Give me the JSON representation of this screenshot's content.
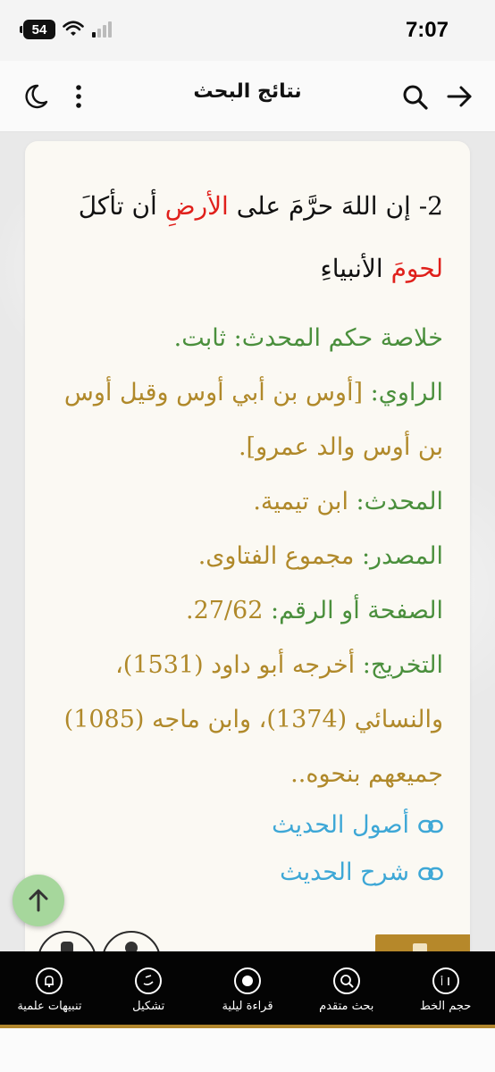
{
  "status_bar": {
    "time": "7:07",
    "battery": "54"
  },
  "header": {
    "title": "نتائج البحث"
  },
  "hadith": {
    "number": "2-",
    "text_before": "إن اللهَ حرَّمَ على",
    "word_earth": "الأرضِ",
    "text_mid": "أن تأكلَ",
    "word_flesh": "لحومَ",
    "text_after": "الأنبياءِ"
  },
  "meta": {
    "ruling_label": "خلاصة حكم المحدث:",
    "ruling_value": "ثابت.",
    "narrator_label": "الراوي:",
    "narrator_value": "[أوس بن أبي أوس وقيل أوس بن أوس والد عمرو].",
    "scholar_label": "المحدث:",
    "scholar_value": "ابن تيمية.",
    "source_label": "المصدر:",
    "source_value": "مجموع الفتاوى.",
    "page_label": "الصفحة أو الرقم:",
    "page_value": "27/62.",
    "takhrij_label": "التخريج:",
    "takhrij_value": "أخرجه أبو داود (1531)، والنسائي (1374)، وابن ماجه (1085) جميعهم بنحوه.."
  },
  "links": {
    "usool": "أصول الحديث",
    "sharh": "شرح الحديث"
  },
  "bottom_nav": {
    "items": [
      {
        "label": "حجم الخط",
        "icon": "font-size-icon"
      },
      {
        "label": "بحث متقدم",
        "icon": "advanced-search-icon"
      },
      {
        "label": "قراءة ليلية",
        "icon": "night-reading-icon"
      },
      {
        "label": "تشكيل",
        "icon": "tashkeel-icon"
      },
      {
        "label": "تنبيهات علمية",
        "icon": "bell-icon"
      }
    ]
  },
  "colors": {
    "accent_gold": "#b1862c",
    "ruling_green": "#4a8f3c",
    "value_gold": "#b0892a",
    "link_blue": "#3da7d6",
    "highlight_red": "#e0201b"
  }
}
